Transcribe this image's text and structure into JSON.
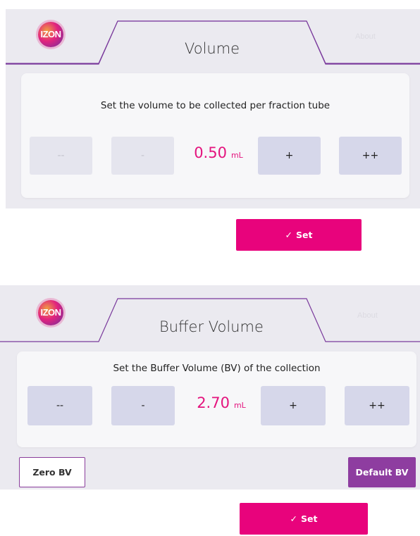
{
  "colors": {
    "accent": "#e8037c",
    "value_text": "#e4147e",
    "purple": "#8e3da0",
    "panel_bg": "#ebeaf0",
    "stepper_enabled": "#d6d7ea",
    "stepper_disabled": "#e5e5ee"
  },
  "screen1": {
    "logo_text": "IZON",
    "tab_title": "Volume",
    "inactive_tab": "About",
    "prompt": "Set the volume to be collected per fraction tube",
    "buttons": {
      "dec_large": "--",
      "dec": "-",
      "inc": "+",
      "inc_large": "++"
    },
    "value": "0.50",
    "unit": "mL",
    "set_check_icon": "check-icon",
    "set_label": "Set"
  },
  "screen2": {
    "logo_text": "IZON",
    "tab_title": "Buffer Volume",
    "inactive_tab": "About",
    "prompt": "Set the Buffer Volume (BV) of the collection",
    "buttons": {
      "dec_large": "--",
      "dec": "-",
      "inc": "+",
      "inc_large": "++"
    },
    "value": "2.70",
    "unit": "mL",
    "zero_label": "Zero BV",
    "default_label": "Default BV",
    "set_label": "Set"
  }
}
